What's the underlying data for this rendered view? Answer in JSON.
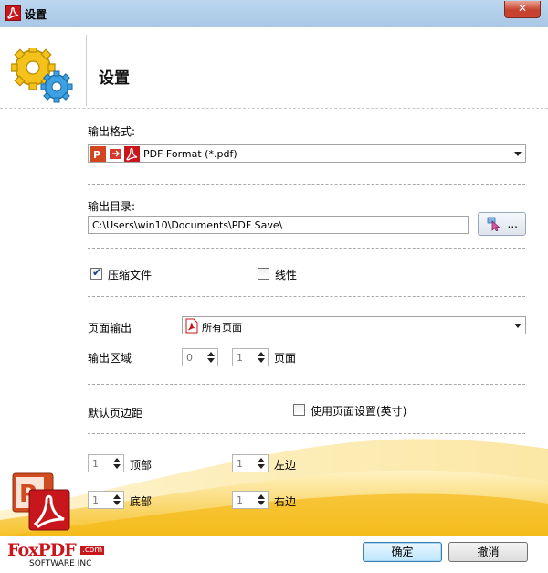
{
  "window": {
    "title": "设置",
    "close_label": "✕"
  },
  "header": {
    "heading": "设置"
  },
  "output_format": {
    "label": "输出格式:",
    "selected": "PDF Format (*.pdf)"
  },
  "output_dir": {
    "label": "输出目录:",
    "path": "C:\\Users\\win10\\Documents\\PDF Save\\",
    "browse_label": "..."
  },
  "options": {
    "compress": {
      "label": "压缩文件",
      "checked": true
    },
    "linearize": {
      "label": "线性",
      "checked": false
    }
  },
  "page_output": {
    "label": "页面输出",
    "selected": "所有页面"
  },
  "output_range": {
    "label": "输出区域",
    "from": "0",
    "to": "1",
    "unit": "页面"
  },
  "margins": {
    "label": "默认页边距",
    "use_page_settings": {
      "label": "使用页面设置(英寸)",
      "checked": false
    },
    "top": {
      "value": "1",
      "label": "顶部"
    },
    "left": {
      "value": "1",
      "label": "左边"
    },
    "bottom": {
      "value": "1",
      "label": "底部"
    },
    "right": {
      "value": "1",
      "label": "右边"
    }
  },
  "buttons": {
    "ok": "确定",
    "cancel": "撤消"
  },
  "brand": {
    "name": "FoxPDF",
    "domain": ".com",
    "tagline": "SOFTWARE INC"
  },
  "colors": {
    "brand_red": "#c8161d",
    "titlebar": "#b5d1ec",
    "swoosh": "#f7c531"
  }
}
